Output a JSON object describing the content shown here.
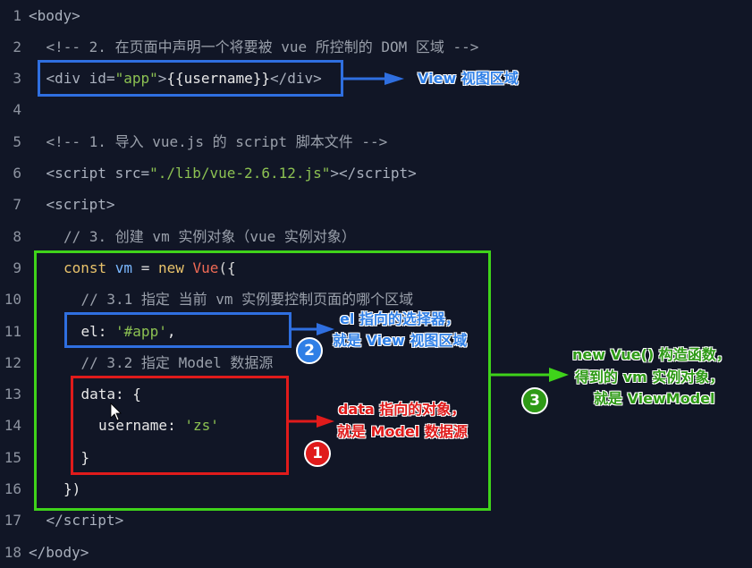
{
  "editor": {
    "lines": [
      {
        "n": "1",
        "indent": 0,
        "tokens": [
          [
            "<body>",
            "tag"
          ]
        ]
      },
      {
        "n": "2",
        "indent": 1,
        "tokens": [
          [
            "<!-- 2. 在页面中声明一个将要被 vue 所控制的 DOM 区域 -->",
            "cm"
          ]
        ]
      },
      {
        "n": "3",
        "indent": 1,
        "tokens": [
          [
            "<div ",
            "tag"
          ],
          [
            "id=",
            "attr"
          ],
          [
            "\"app\"",
            "str"
          ],
          [
            ">",
            "tag"
          ],
          [
            "{{username}}",
            "txt"
          ],
          [
            "</div>",
            "tag"
          ]
        ]
      },
      {
        "n": "4",
        "indent": 0,
        "tokens": []
      },
      {
        "n": "5",
        "indent": 1,
        "tokens": [
          [
            "<!-- 1. 导入 vue.js 的 script 脚本文件 -->",
            "cm"
          ]
        ]
      },
      {
        "n": "6",
        "indent": 1,
        "tokens": [
          [
            "<script ",
            "tag"
          ],
          [
            "src=",
            "attr"
          ],
          [
            "\"./lib/vue-2.6.12.js\"",
            "str"
          ],
          [
            "></script>",
            "tag"
          ]
        ]
      },
      {
        "n": "7",
        "indent": 1,
        "tokens": [
          [
            "<script>",
            "tag"
          ]
        ]
      },
      {
        "n": "8",
        "indent": 2,
        "tokens": [
          [
            "// 3. 创建 vm 实例对象（vue 实例对象）",
            "cm"
          ]
        ]
      },
      {
        "n": "9",
        "indent": 2,
        "tokens": [
          [
            "const ",
            "kw"
          ],
          [
            "vm ",
            "var"
          ],
          [
            "= ",
            "op"
          ],
          [
            "new ",
            "kw"
          ],
          [
            "Vue",
            "cls"
          ],
          [
            "({",
            "op"
          ]
        ]
      },
      {
        "n": "10",
        "indent": 3,
        "tokens": [
          [
            "// 3.1 指定 当前 vm 实例要控制页面的哪个区域",
            "cm"
          ]
        ]
      },
      {
        "n": "11",
        "indent": 3,
        "tokens": [
          [
            "el: ",
            "txt"
          ],
          [
            "'#app'",
            "str"
          ],
          [
            ",",
            "txt"
          ]
        ]
      },
      {
        "n": "12",
        "indent": 3,
        "tokens": [
          [
            "// 3.2 指定 Model 数据源",
            "cm"
          ]
        ]
      },
      {
        "n": "13",
        "indent": 3,
        "tokens": [
          [
            "data: {",
            "txt"
          ]
        ]
      },
      {
        "n": "14",
        "indent": 4,
        "tokens": [
          [
            "username: ",
            "txt"
          ],
          [
            "'zs'",
            "str"
          ]
        ]
      },
      {
        "n": "15",
        "indent": 3,
        "tokens": [
          [
            "}",
            "txt"
          ]
        ]
      },
      {
        "n": "16",
        "indent": 2,
        "tokens": [
          [
            "})",
            "txt"
          ]
        ]
      },
      {
        "n": "17",
        "indent": 1,
        "tokens": [
          [
            "</script>",
            "tag"
          ]
        ]
      },
      {
        "n": "18",
        "indent": 0,
        "tokens": [
          [
            "</body>",
            "tag"
          ]
        ]
      }
    ]
  },
  "annotations": {
    "view": "View 视图区域",
    "el_line1": "el 指向的选择器，",
    "el_line2": "就是 View 视图区域",
    "data_line1": "data 指向的对象，",
    "data_line2": "就是 Model 数据源",
    "vm_line1": "new Vue() 构造函数，",
    "vm_line2": "得到的 vm 实例对象，",
    "vm_line3": "就是 ViewModel",
    "badge1": "1",
    "badge2": "2",
    "badge3": "3"
  },
  "colors": {
    "view_blue": "#2f6fe0",
    "model_red": "#e01b1b",
    "viewmodel_green": "#3fd31a",
    "background": "#111626"
  }
}
